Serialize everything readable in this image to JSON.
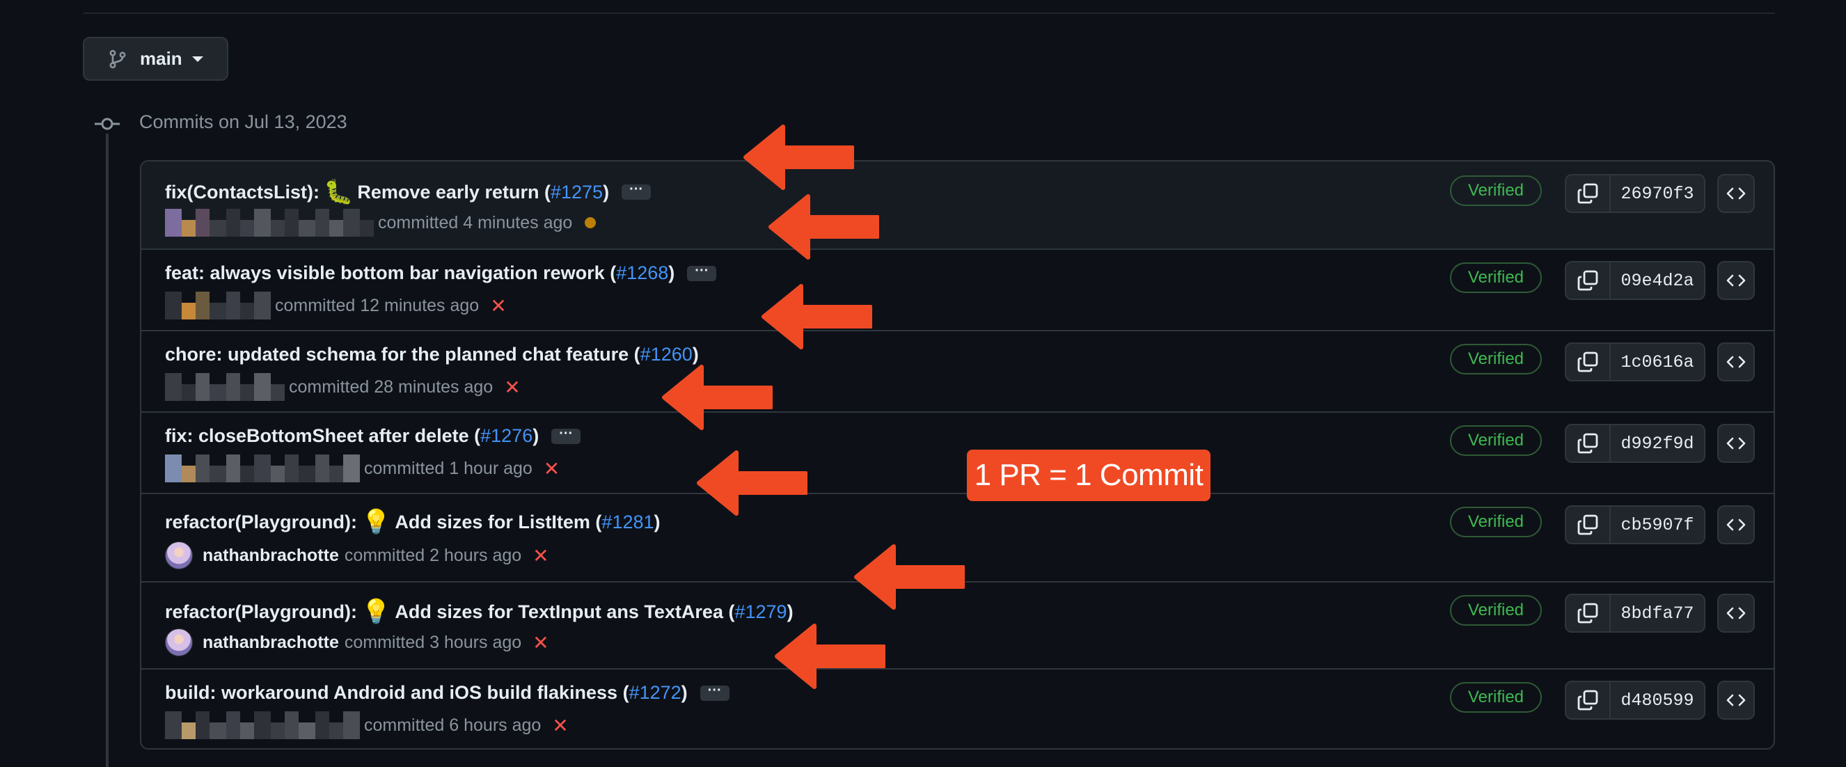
{
  "branch": {
    "name": "main"
  },
  "timeline": {
    "date_label": "Commits on Jul 13, 2023"
  },
  "commits": [
    {
      "type": "fix(ContactsList):",
      "emoji": "🐛",
      "message": "Remove early return",
      "pr": "#1275",
      "has_ellipsis": true,
      "author": "",
      "time": "committed 4 minutes ago",
      "status": "pending",
      "verified": "Verified",
      "sha": "26970f3"
    },
    {
      "type": "feat:",
      "emoji": "",
      "message": "always visible bottom bar navigation rework",
      "pr": "#1268",
      "has_ellipsis": true,
      "author": "",
      "time": "committed 12 minutes ago",
      "status": "failed",
      "verified": "Verified",
      "sha": "09e4d2a"
    },
    {
      "type": "chore:",
      "emoji": "",
      "message": "updated schema for the planned chat feature",
      "pr": "#1260",
      "has_ellipsis": false,
      "author": "",
      "time": "committed 28 minutes ago",
      "status": "failed",
      "verified": "Verified",
      "sha": "1c0616a"
    },
    {
      "type": "fix:",
      "emoji": "",
      "message": "closeBottomSheet after delete",
      "pr": "#1276",
      "has_ellipsis": true,
      "author": "",
      "time": "committed 1 hour ago",
      "status": "failed",
      "verified": "Verified",
      "sha": "d992f9d"
    },
    {
      "type": "refactor(Playground):",
      "emoji": "💡",
      "message": "Add sizes for ListItem",
      "pr": "#1281",
      "has_ellipsis": false,
      "author": "nathanbrachotte",
      "time": "committed 2 hours ago",
      "status": "failed",
      "verified": "Verified",
      "sha": "cb5907f"
    },
    {
      "type": "refactor(Playground):",
      "emoji": "💡",
      "message": "Add sizes for TextInput ans TextArea",
      "pr": "#1279",
      "has_ellipsis": false,
      "author": "nathanbrachotte",
      "time": "committed 3 hours ago",
      "status": "failed",
      "verified": "Verified",
      "sha": "8bdfa77"
    },
    {
      "type": "build:",
      "emoji": "",
      "message": "workaround Android and iOS build flakiness",
      "pr": "#1272",
      "has_ellipsis": true,
      "author": "",
      "time": "committed 6 hours ago",
      "status": "failed",
      "verified": "Verified",
      "sha": "d480599"
    }
  ],
  "annotation": {
    "callout": "1 PR = 1 Commit",
    "arrow_color": "#f04a24"
  },
  "colors": {
    "link": "#4493f8",
    "verified": "#3fb950",
    "failed": "#f85149",
    "pending": "#bb8009",
    "background": "#0d1117"
  },
  "icons": {
    "branch": "git-branch-icon",
    "commit": "git-commit-icon",
    "copy": "copy-icon",
    "browse": "code-icon",
    "failed": "x-icon",
    "pending": "dot-icon"
  }
}
